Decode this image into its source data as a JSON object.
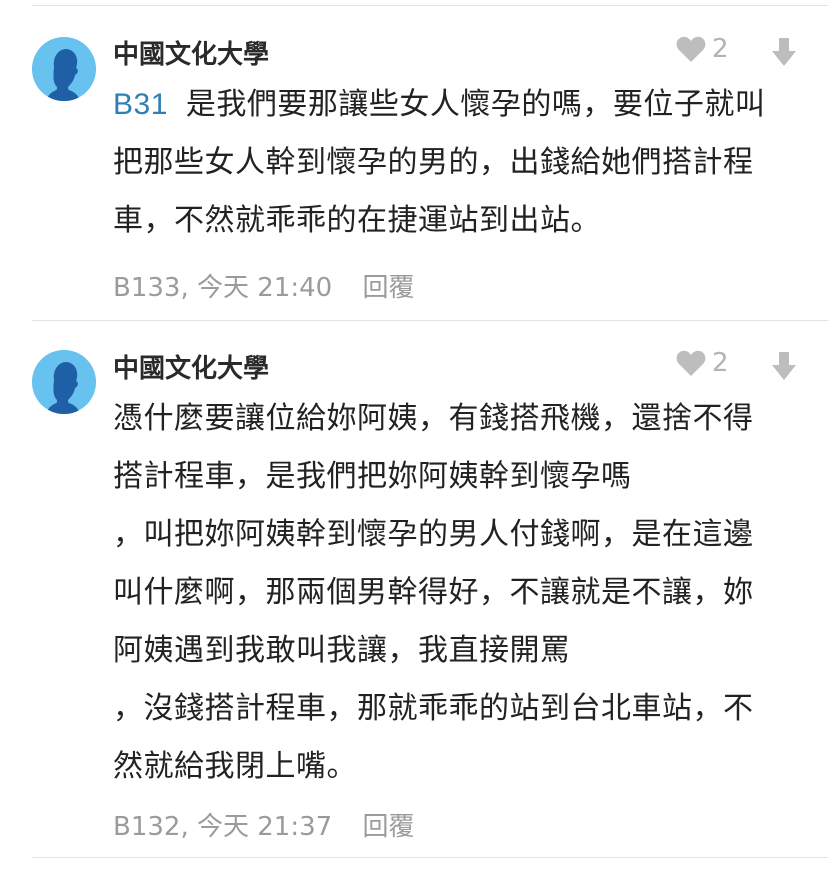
{
  "comments": [
    {
      "author": "中國文化大學",
      "likes": "2",
      "floor_ref": "B31",
      "lines": [
        "是我們要那讓些女人懷孕的嗎，要位子就叫",
        "把那些女人幹到懷孕的男的，出錢給她們搭計程",
        "車，不然就乖乖的在捷運站到出站。"
      ],
      "floor": "B133,",
      "time": "今天 21:40",
      "reply_label": "回覆"
    },
    {
      "author": "中國文化大學",
      "likes": "2",
      "lines": [
        "憑什麼要讓位給妳阿姨，有錢搭飛機，還捨不得",
        "搭計程車，是我們把妳阿姨幹到懷孕嗎",
        "，叫把妳阿姨幹到懷孕的男人付錢啊，是在這邊",
        "叫什麼啊，那兩個男幹得好，不讓就是不讓，妳",
        "阿姨遇到我敢叫我讓，我直接開罵",
        "，沒錢搭計程車，那就乖乖的站到台北車站，不",
        "然就給我閉上嘴。"
      ],
      "floor": "B132,",
      "time": "今天 21:37",
      "reply_label": "回覆"
    }
  ],
  "colors": {
    "avatar_bg": "#67c2ef",
    "avatar_figure": "#1f5fa6",
    "floor_ref": "#2f7fb6",
    "meta": "#9b9b9b",
    "icon": "#b3b3b3"
  },
  "icons": {
    "avatar": "person-silhouette-icon",
    "like": "heart-icon",
    "downvote": "down-arrow-icon"
  }
}
